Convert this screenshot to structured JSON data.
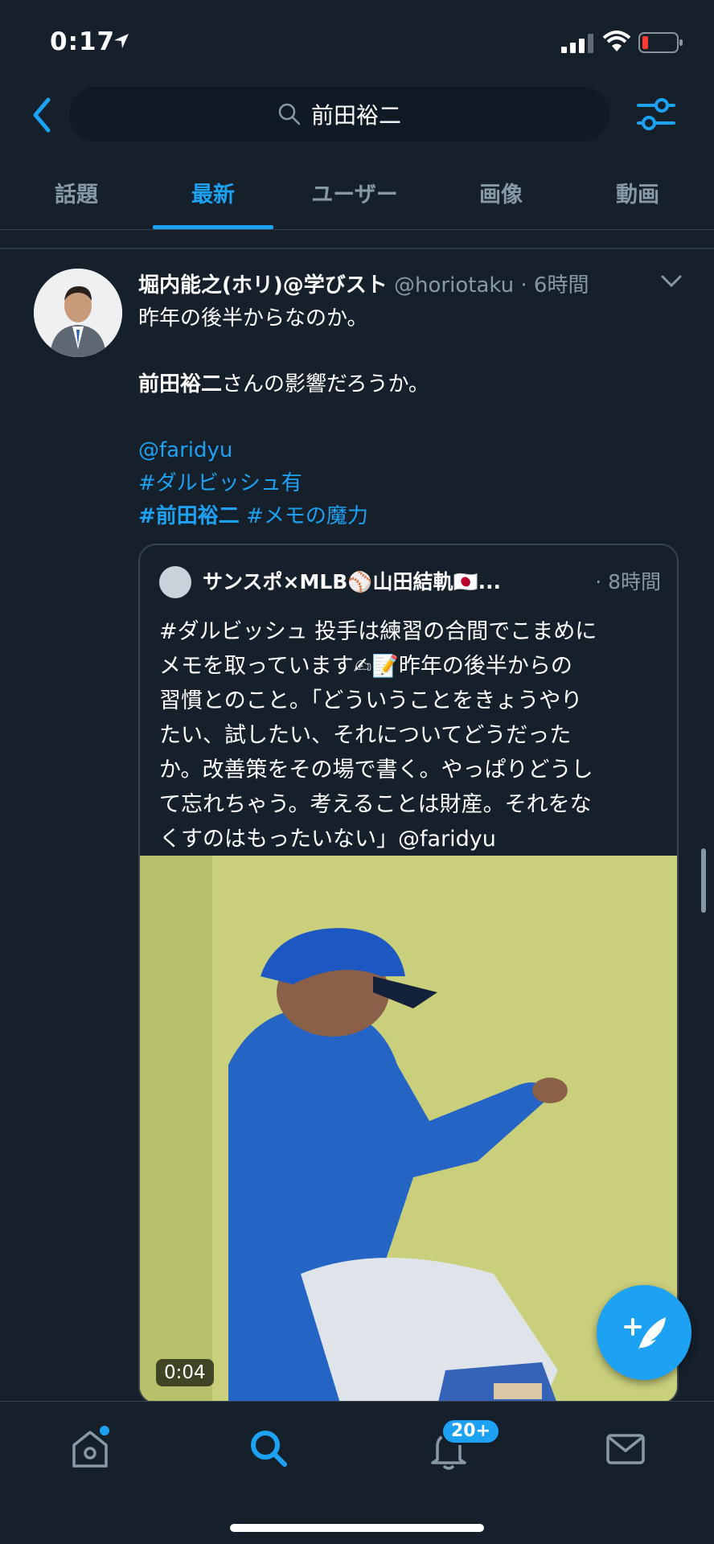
{
  "status_bar": {
    "time": "0:17"
  },
  "search": {
    "query": "前田裕二"
  },
  "tabs": [
    {
      "label": "話題"
    },
    {
      "label": "最新"
    },
    {
      "label": "ユーザー"
    },
    {
      "label": "画像"
    },
    {
      "label": "動画"
    }
  ],
  "active_tab": "最新",
  "tweet": {
    "author_name": "堀内能之(ホリ)@学びスト",
    "handle_time": "@horiotaku · 6時間",
    "line1": "昨年の後半からなのか。",
    "line2_bold": "前田裕二",
    "line2_rest": "さんの影響だろうか。",
    "mention": "@faridyu",
    "hashtag1": "#ダルビッシュ有",
    "hashtag2": "#前田裕二",
    "hashtag3": "#メモの魔力"
  },
  "quoted": {
    "author_name": "サンスポ×MLB⚾山田結軌🇯🇵...",
    "time": "· 8時間",
    "lines": [
      "#ダルビッシュ 投手は練習の合間でこまめに",
      "メモを取っています✍📝昨年の後半からの",
      "習慣とのこと。「どういうことをきょうやり",
      "たい、試したい、それについてどうだった",
      "か。改善策をその場で書く。やっぱりどうし",
      "て忘れちゃう。考えることは財産。それをな",
      "くすのはもったいない」@faridyu"
    ],
    "video_duration": "0:04"
  },
  "notifications_badge": "20+",
  "colors": {
    "accent": "#1da1f2",
    "background": "#15202b",
    "muted": "#8899a6"
  }
}
